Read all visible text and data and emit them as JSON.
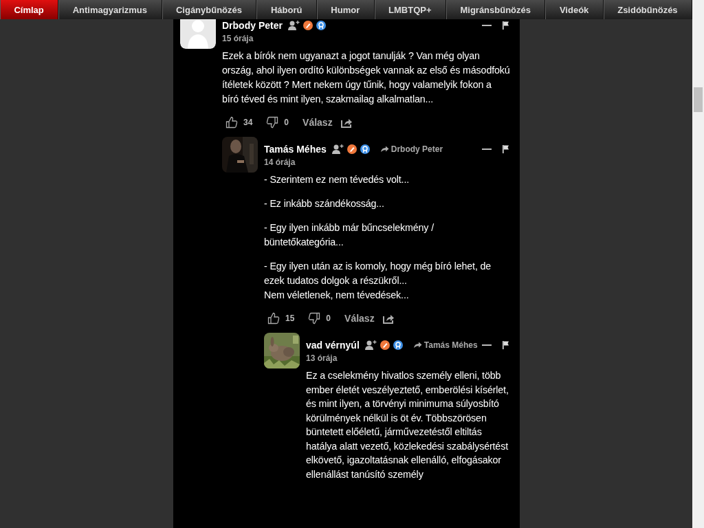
{
  "nav": [
    {
      "label": "Címlap",
      "selected": true
    },
    {
      "label": "Antimagyarizmus",
      "selected": false
    },
    {
      "label": "Cigánybűnözés",
      "selected": false
    },
    {
      "label": "Háború",
      "selected": false
    },
    {
      "label": "Humor",
      "selected": false
    },
    {
      "label": "LMBTQP+",
      "selected": false
    },
    {
      "label": "Migránsbűnözés",
      "selected": false
    },
    {
      "label": "Videók",
      "selected": false
    },
    {
      "label": "Zsidóbűnözés",
      "selected": false
    }
  ],
  "comments": [
    {
      "author": "Drbody Peter",
      "avatar": {
        "kind": "placeholder"
      },
      "time": "15 órája",
      "paragraphs": [
        "Ezek a bírók nem ugyanazt a jogot tanulják ? Van még olyan ország, ahol ilyen ordító különbségek vannak az első és másodfokú ítéletek között ? Mert nekem úgy tűnik, hogy valamelyik fokon a bíró téved és mint ilyen, szakmailag alkalmatlan..."
      ],
      "likes": "34",
      "dislikes": "0",
      "reply_label": "Válasz",
      "children": [
        {
          "author": "Tamás Méhes",
          "reply_to": "Drbody Peter",
          "time": "14 órája",
          "paragraphs": [
            "- Szerintem ez nem tévedés volt...",
            "- Ez inkább szándékosság...",
            "- Egy ilyen inkább már bűncselekmény / büntetőkategória...",
            "- Egy ilyen után az is komoly, hogy még bíró lehet, de ezek tudatos dolgok a részükről...\nNem véletlenek, nem tévedések..."
          ],
          "likes": "15",
          "dislikes": "0",
          "reply_label": "Válasz",
          "children": [
            {
              "author": "vad vérnyúl",
              "reply_to": "Tamás Méhes",
              "time": "13 órája",
              "paragraphs": [
                "Ez a cselekmény hivatlos személy elleni, több ember életét veszélyeztető, emberölési kísérlet, és mint ilyen, a törvényi minimuma súlyosbító körülmények nélkül is öt év. Többszörösen büntetett előéletű, járművezetéstől eltiltás hatálya alatt vezető, közlekedési szabálysértést elkövető, igazoltatásnak ellenálló, elfogásakor ellenállást tanúsító személy"
              ]
            }
          ]
        }
      ]
    }
  ]
}
